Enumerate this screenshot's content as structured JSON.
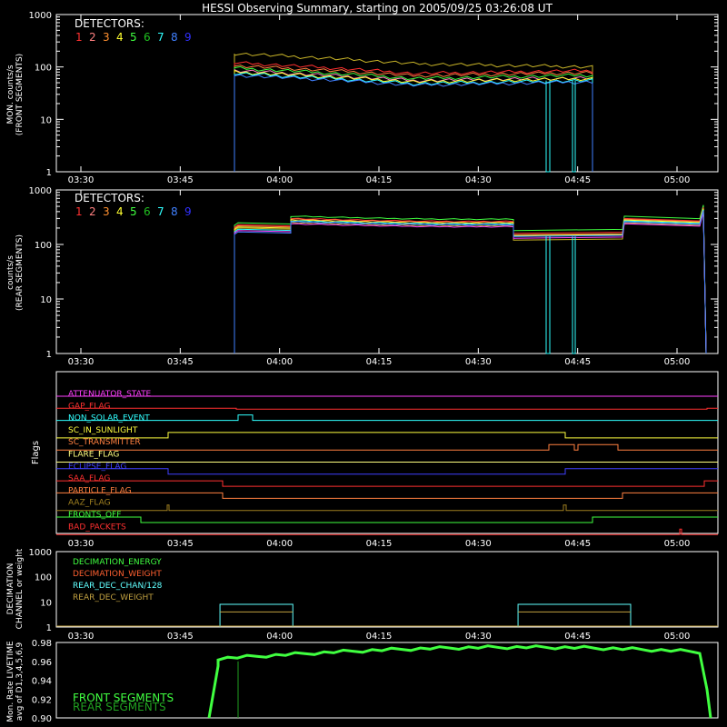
{
  "title": "HESSI Observing Summary, starting on 2005/09/25 03:26:08 UT",
  "detector_colors": [
    "#ff3030",
    "#ff8080",
    "#ff9030",
    "#ffff30",
    "#40ff40",
    "#20c020",
    "#30ffff",
    "#4080ff",
    "#3030ff"
  ],
  "chart_data": [
    {
      "type": "line",
      "ylabel_1": "MON. counts/s",
      "ylabel_2": "(FRONT SEGMENTS)",
      "legend_title": "DETECTORS:",
      "legend_numbers": [
        "1",
        "2",
        "3",
        "4",
        "5",
        "6",
        "7",
        "8",
        "9"
      ],
      "scale": "log",
      "ylim": [
        1,
        1000
      ],
      "y_ticks": [
        "1",
        "10",
        "100",
        "1000"
      ],
      "x_ticks": [
        "03:30",
        "03:45",
        "04:00",
        "04:15",
        "04:30",
        "04:45",
        "05:00"
      ],
      "series_levels": [
        {
          "color": "#c8b428",
          "start": 180,
          "mid": 115,
          "end": 100
        },
        {
          "color": "#ff3030",
          "start": 120,
          "mid": 75,
          "end": 85
        },
        {
          "color": "#ff8040",
          "start": 105,
          "mid": 68,
          "end": 78
        },
        {
          "color": "#40ff40",
          "start": 95,
          "mid": 60,
          "end": 70
        },
        {
          "color": "#ff80c0",
          "start": 85,
          "mid": 55,
          "end": 62
        },
        {
          "color": "#ffff30",
          "start": 80,
          "mid": 52,
          "end": 60
        },
        {
          "color": "#30ffff",
          "start": 75,
          "mid": 48,
          "end": 55
        },
        {
          "color": "#4080ff",
          "start": 70,
          "mid": 45,
          "end": 52
        }
      ]
    },
    {
      "type": "line",
      "ylabel_1": "counts/s",
      "ylabel_2": "(REAR SEGMENTS)",
      "legend_title": "DETECTORS:",
      "legend_numbers": [
        "1",
        "2",
        "3",
        "4",
        "5",
        "6",
        "7",
        "8",
        "9"
      ],
      "scale": "log",
      "ylim": [
        1,
        1000
      ],
      "y_ticks": [
        "1",
        "10",
        "100",
        "1000"
      ],
      "x_ticks": [
        "03:30",
        "03:45",
        "04:00",
        "04:15",
        "04:30",
        "04:45",
        "05:00"
      ]
    },
    {
      "type": "flags",
      "ylabel": "Flags",
      "x_ticks": [
        "03:30",
        "03:45",
        "04:00",
        "04:15",
        "04:30",
        "04:45",
        "05:00"
      ],
      "flags": [
        {
          "name": "ATTENUATOR_STATE",
          "color": "#ff40ff"
        },
        {
          "name": "GAP_FLAG",
          "color": "#ff3030"
        },
        {
          "name": "NON_SOLAR_EVENT",
          "color": "#30ffff"
        },
        {
          "name": "SC_IN_SUNLIGHT",
          "color": "#ffff40"
        },
        {
          "name": "SC_TRANSMITTER",
          "color": "#ff8040"
        },
        {
          "name": "FLARE_FLAG",
          "color": "#ffff80"
        },
        {
          "name": "ECLIPSE_FLAG",
          "color": "#4040ff"
        },
        {
          "name": "SAA_FLAG",
          "color": "#ff3030"
        },
        {
          "name": "PARTICLE_FLAG",
          "color": "#ff8040"
        },
        {
          "name": "AAZ_FLAG",
          "color": "#a08020"
        },
        {
          "name": "FRONTS_OFF",
          "color": "#40ff40"
        },
        {
          "name": "BAD_PACKETS",
          "color": "#ff3030"
        }
      ]
    },
    {
      "type": "line",
      "ylabel_1": "DECIMATION",
      "ylabel_2": "CHANNEL or weight",
      "scale": "log",
      "ylim": [
        1,
        1000
      ],
      "y_ticks": [
        "1",
        "10",
        "100",
        "1000"
      ],
      "x_ticks": [
        "03:30",
        "03:45",
        "04:00",
        "04:15",
        "04:30",
        "04:45",
        "05:00"
      ],
      "legend": [
        {
          "name": "DECIMATION_ENERGY",
          "color": "#40ff40"
        },
        {
          "name": "DECIMATION_WEIGHT",
          "color": "#ff6030"
        },
        {
          "name": "REAR_DEC_CHAN/128",
          "color": "#60ffff"
        },
        {
          "name": "REAR_DEC_WEIGHT",
          "color": "#c0a040"
        }
      ],
      "blocks": [
        {
          "start": "03:51",
          "end": "04:02",
          "chan": 8,
          "weight": 4
        },
        {
          "start": "04:36",
          "end": "04:53",
          "chan": 8,
          "weight": 4
        }
      ]
    },
    {
      "type": "line",
      "ylabel_1": "Mon. Rate LIVETIME",
      "ylabel_2": "avg of D1,3,4,5,6,9",
      "ylim": [
        0.9,
        0.98
      ],
      "y_ticks": [
        "0.90",
        "0.92",
        "0.94",
        "0.96",
        "0.98"
      ],
      "legend": [
        {
          "name": "FRONT SEGMENTS",
          "color": "#40ff40"
        },
        {
          "name": "REAR SEGMENTS",
          "color": "#20a020"
        }
      ]
    }
  ]
}
